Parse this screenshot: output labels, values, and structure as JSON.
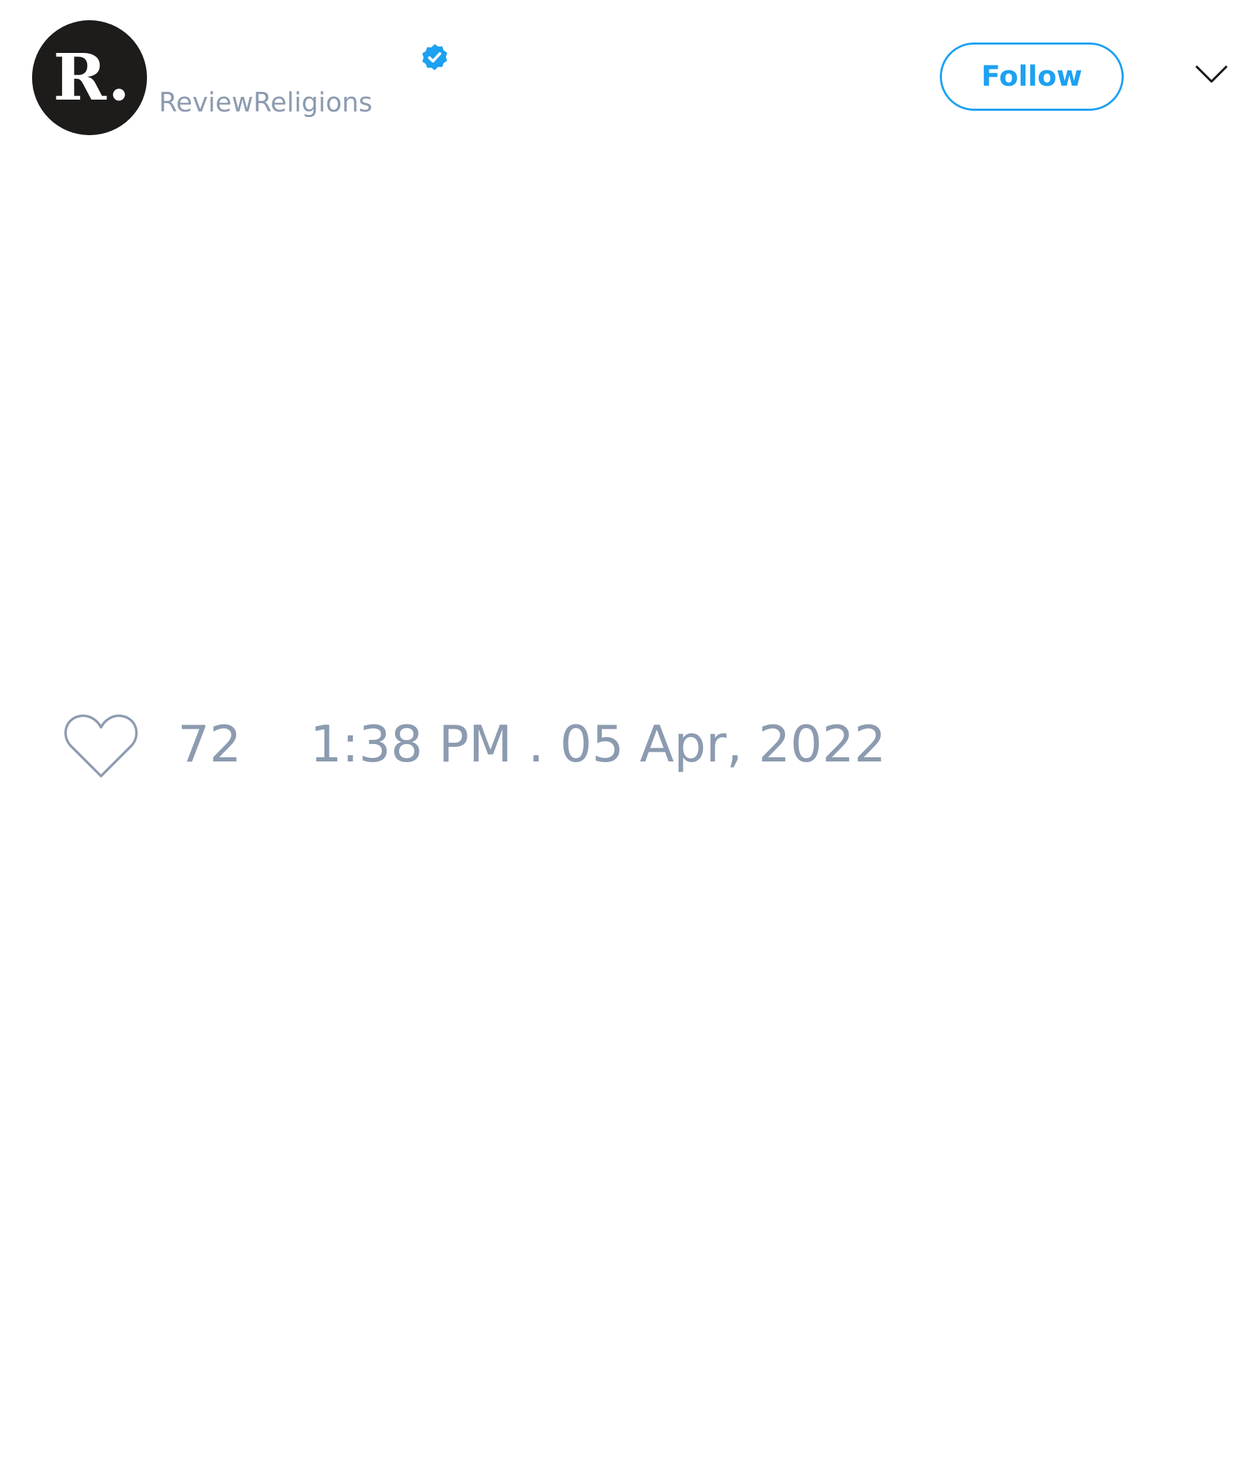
{
  "header": {
    "avatar_text": "R.",
    "display_name": "",
    "handle": "ReviewReligions",
    "verified": true,
    "follow_label": "Follow"
  },
  "tweet": {
    "text": ""
  },
  "footer": {
    "like_count": "72",
    "timestamp": "1:38 PM . 05 Apr, 2022"
  },
  "colors": {
    "accent": "#1da1f2",
    "muted_text": "#8c9bb0",
    "avatar_bg": "#1e1b1b",
    "background": "#ffffff"
  },
  "icons": {
    "verified": "verified-badge-icon",
    "menu": "chevron-down-icon",
    "like": "heart-outline-icon"
  }
}
